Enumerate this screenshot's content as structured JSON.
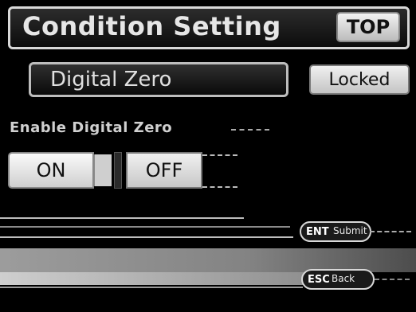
{
  "header": {
    "title": "Condition Setting",
    "top_label": "TOP"
  },
  "item": {
    "name": "Digital Zero",
    "status": "Locked"
  },
  "setting": {
    "label": "Enable Digital Zero",
    "on_label": "ON",
    "off_label": "OFF",
    "selected": "ON"
  },
  "keys": {
    "ent_key": "ENT",
    "ent_action": "Submit",
    "esc_key": "ESC",
    "esc_action": "Back"
  },
  "colors": {
    "background": "#000000",
    "button_face": "#e6e6e6",
    "frame": "#d8d8d8"
  }
}
